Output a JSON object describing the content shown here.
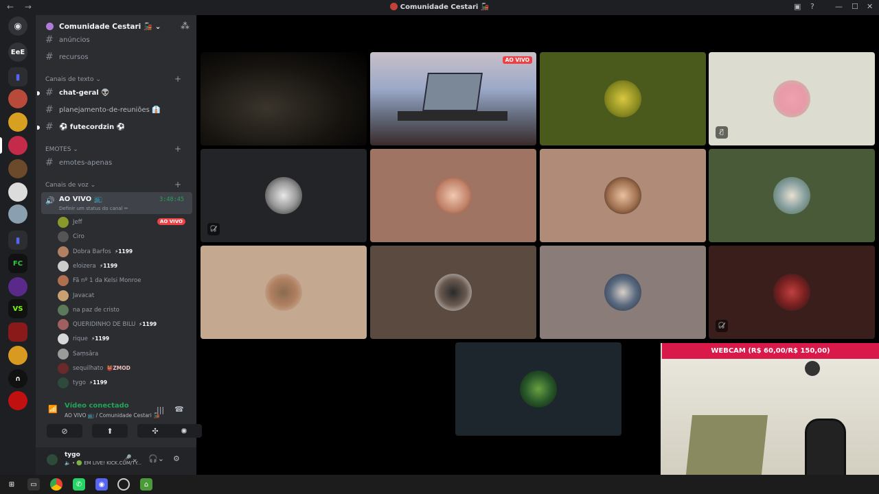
{
  "window": {
    "title": "Comunidade Cestari 🚂"
  },
  "rail": {
    "home_label": "EeE"
  },
  "server": {
    "name": "Comunidade Cestari 🚂"
  },
  "channels_top": [
    {
      "label": "anúncios"
    },
    {
      "label": "recursos"
    }
  ],
  "categories": {
    "text": "Canais de texto",
    "emotes": "EMOTES",
    "voice": "Canais de voz"
  },
  "text_channels": [
    {
      "label": "chat-geral 👽"
    },
    {
      "label": "planejamento-de-reuniões 👔"
    },
    {
      "label": "⚽ futecordzin ⚽"
    }
  ],
  "emote_channels": [
    {
      "label": "emotes-apenas"
    }
  ],
  "voice_channel": {
    "label": "AO VIVO 📺",
    "time": "3:48:45",
    "status_placeholder": "Definir um status do canal ✏"
  },
  "voice_users": [
    {
      "name": "Jeff",
      "badge": "",
      "live": "AO VIVO",
      "color": "#8a9a2a"
    },
    {
      "name": "Ciro",
      "badge": "",
      "live": "",
      "color": "#555"
    },
    {
      "name": "Dobra Barfos",
      "badge": "⚡1199",
      "live": "",
      "color": "#b08060"
    },
    {
      "name": "eloizera",
      "badge": "⚡1199",
      "live": "",
      "color": "#ccc"
    },
    {
      "name": "Fã nº 1 da Kelsi Monroe",
      "badge": "",
      "live": "",
      "color": "#b07050"
    },
    {
      "name": "Javacat",
      "badge": "",
      "live": "",
      "color": "#c9a070"
    },
    {
      "name": "na paz de cristo",
      "badge": "",
      "live": "",
      "color": "#5a7a5a"
    },
    {
      "name": "QUERIDINHO DE BILU",
      "badge": "⚡1199",
      "live": "",
      "color": "#a06060"
    },
    {
      "name": "rique",
      "badge": "⚡1199",
      "live": "",
      "color": "#d8d8d8"
    },
    {
      "name": "Saṃsāra",
      "badge": "",
      "live": "",
      "color": "#9a9a9a"
    },
    {
      "name": "sequilhato",
      "badge": "👹ZMOD",
      "live": "",
      "color": "#6a2a2a"
    },
    {
      "name": "tygo",
      "badge": "⚡1199",
      "live": "",
      "color": "#2e4a3a"
    }
  ],
  "voice_panel": {
    "connected": "Vídeo conectado",
    "location": "AO VIVO 📺 / Comunidade Cestari 🚂"
  },
  "user_panel": {
    "name": "tygo",
    "status": "🔈 • 🟢 EM LIVE! KICK.COM/TY..."
  },
  "stage": {
    "live_badge": "AO VIVO",
    "webcam_label": "WEBCAM (R$ 60,00/R$ 150,00)"
  },
  "colors": {
    "accent": "#5865f2",
    "green": "#23a559",
    "red": "#ed4245",
    "webcam_bar": "#d9194a"
  }
}
